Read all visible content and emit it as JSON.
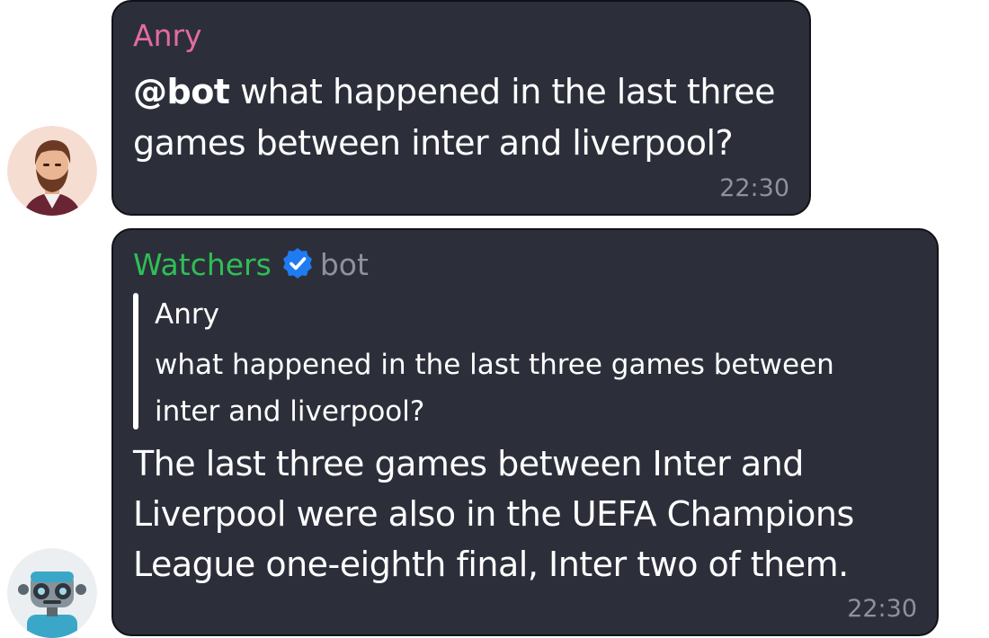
{
  "messages": [
    {
      "sender": "Anry",
      "sender_color": "#e36aa3",
      "mention": "@bot",
      "text": " what happened in the last three games between inter and liverpool?",
      "time": "22:30",
      "avatar_icon": "bearded-man-avatar-icon"
    },
    {
      "sender": "Watchers",
      "sender_color": "#2fbf55",
      "badge_icon": "verified-badge-icon",
      "tag": "bot",
      "quote": {
        "sender": "Anry",
        "text": "what happened in the last three games between inter and liverpool?"
      },
      "text": "The last three games between Inter and Liverpool were also in the UEFA Champions League one-eighth final, Inter two of them.",
      "time": "22:30",
      "avatar_icon": "robot-avatar-icon"
    }
  ],
  "colors": {
    "bubble_bg": "#2c2f3a",
    "verified_blue": "#1f7bf2",
    "timestamp": "#8e929b"
  }
}
